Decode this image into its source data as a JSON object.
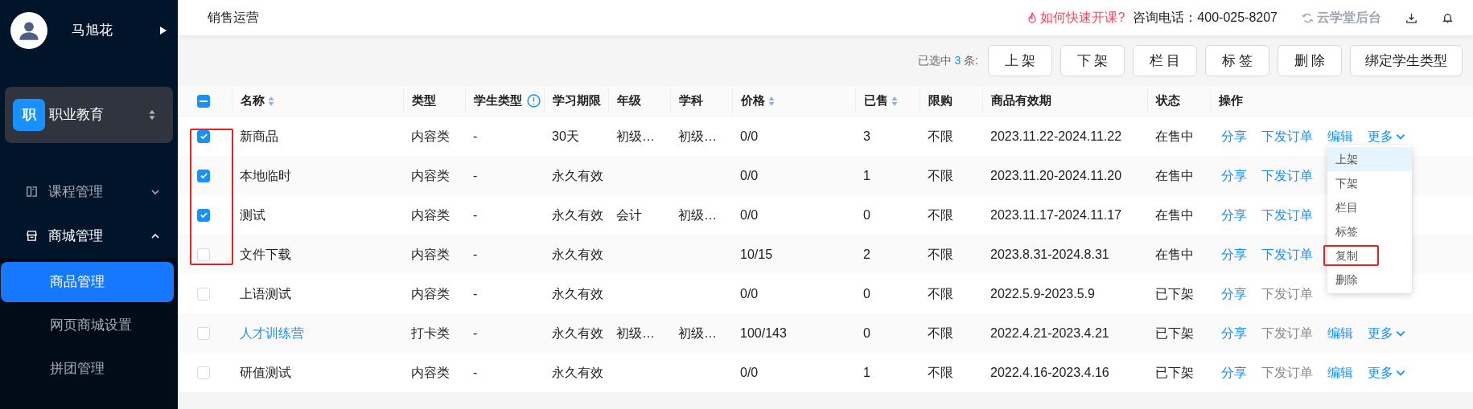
{
  "sidebar": {
    "user": {
      "name": "马旭花"
    },
    "org": {
      "badge": "职",
      "name": "职业教育"
    },
    "menu": [
      {
        "label": "课程管理",
        "expanded": false
      },
      {
        "label": "商城管理",
        "expanded": true,
        "children": [
          {
            "label": "商品管理",
            "selected": true
          },
          {
            "label": "网页商城设置",
            "selected": false
          },
          {
            "label": "拼团管理",
            "selected": false
          }
        ]
      }
    ]
  },
  "header": {
    "title": "销售运营",
    "help_link": "如何快速开课?",
    "phone": "咨询电话：400-025-8207",
    "switch_link": "云学堂后台"
  },
  "toolbar": {
    "selection_prefix": "已选中",
    "selection_count": "3",
    "selection_suffix": "条:",
    "buttons": [
      "上 架",
      "下 架",
      "栏 目",
      "标 签",
      "删 除",
      "绑定学生类型"
    ]
  },
  "table": {
    "select_all": {
      "indeterminate": true
    },
    "annotate_selection": true,
    "columns": [
      {
        "label": "名称",
        "sortable": true,
        "info": false
      },
      {
        "label": "类型",
        "sortable": false,
        "info": false
      },
      {
        "label": "学生类型",
        "sortable": false,
        "info": true
      },
      {
        "label": "学习期限",
        "sortable": false,
        "info": false
      },
      {
        "label": "年级",
        "sortable": false,
        "info": false
      },
      {
        "label": "学科",
        "sortable": false,
        "info": false
      },
      {
        "label": "价格",
        "sortable": true,
        "info": false
      },
      {
        "label": "已售",
        "sortable": true,
        "info": false
      },
      {
        "label": "限购",
        "sortable": false,
        "info": false
      },
      {
        "label": "商品有效期",
        "sortable": false,
        "info": false
      },
      {
        "label": "状态",
        "sortable": false,
        "info": false
      },
      {
        "label": "操作",
        "sortable": false,
        "info": false
      }
    ],
    "rows": [
      {
        "selected": true,
        "name_link": false,
        "cells": [
          "新商品",
          "内容类",
          "-",
          "30天",
          "初级…",
          "初级…",
          "0/0",
          "3",
          "不限",
          "2023.11.22-2024.11.22",
          "在售中"
        ],
        "actions": [
          {
            "label": "分享",
            "disabled": false
          },
          {
            "label": "下发订单",
            "disabled": false
          },
          {
            "label": "编辑",
            "disabled": false
          }
        ],
        "more": "更多",
        "more_menu": [
          {
            "label": "上架",
            "highlighted": true,
            "annotated": false
          },
          {
            "label": "下架",
            "highlighted": false,
            "annotated": false
          },
          {
            "label": "栏目",
            "highlighted": false,
            "annotated": false
          },
          {
            "label": "标签",
            "highlighted": false,
            "annotated": false
          },
          {
            "label": "复制",
            "highlighted": false,
            "annotated": true
          },
          {
            "label": "删除",
            "highlighted": false,
            "annotated": false
          }
        ]
      },
      {
        "selected": true,
        "name_link": false,
        "cells": [
          "本地临时",
          "内容类",
          "-",
          "永久有效",
          "",
          "",
          "0/0",
          "1",
          "不限",
          "2023.11.20-2024.11.20",
          "在售中"
        ],
        "actions": [
          {
            "label": "分享",
            "disabled": false
          },
          {
            "label": "下发订单",
            "disabled": false
          }
        ]
      },
      {
        "selected": true,
        "name_link": false,
        "cells": [
          "测试",
          "内容类",
          "-",
          "永久有效",
          "会计",
          "初级…",
          "0/0",
          "0",
          "不限",
          "2023.11.17-2024.11.17",
          "在售中"
        ],
        "actions": [
          {
            "label": "分享",
            "disabled": false
          },
          {
            "label": "下发订单",
            "disabled": false
          }
        ]
      },
      {
        "selected": false,
        "name_link": false,
        "cells": [
          "文件下载",
          "内容类",
          "-",
          "永久有效",
          "",
          "",
          "10/15",
          "2",
          "不限",
          "2023.8.31-2024.8.31",
          "在售中"
        ],
        "actions": [
          {
            "label": "分享",
            "disabled": false
          },
          {
            "label": "下发订单",
            "disabled": false
          }
        ]
      },
      {
        "selected": false,
        "name_link": false,
        "cells": [
          "上语测试",
          "内容类",
          "-",
          "永久有效",
          "",
          "",
          "0/0",
          "0",
          "不限",
          "2022.5.9-2023.5.9",
          "已下架"
        ],
        "actions": [
          {
            "label": "分享",
            "disabled": false
          },
          {
            "label": "下发订单",
            "disabled": true
          }
        ]
      },
      {
        "selected": false,
        "name_link": true,
        "cells": [
          "人才训练营",
          "打卡类",
          "-",
          "永久有效",
          "初级…",
          "初级…",
          "100/143",
          "0",
          "不限",
          "2022.4.21-2023.4.21",
          "已下架"
        ],
        "actions": [
          {
            "label": "分享",
            "disabled": false
          },
          {
            "label": "下发订单",
            "disabled": true
          },
          {
            "label": "编辑",
            "disabled": false
          }
        ],
        "more": "更多"
      },
      {
        "selected": false,
        "name_link": false,
        "cells": [
          "研值测试",
          "内容类",
          "-",
          "永久有效",
          "",
          "",
          "0/0",
          "1",
          "不限",
          "2022.4.16-2023.4.16",
          "已下架"
        ],
        "actions": [
          {
            "label": "分享",
            "disabled": false
          },
          {
            "label": "下发订单",
            "disabled": true
          },
          {
            "label": "编辑",
            "disabled": false
          }
        ],
        "more": "更多"
      }
    ]
  }
}
